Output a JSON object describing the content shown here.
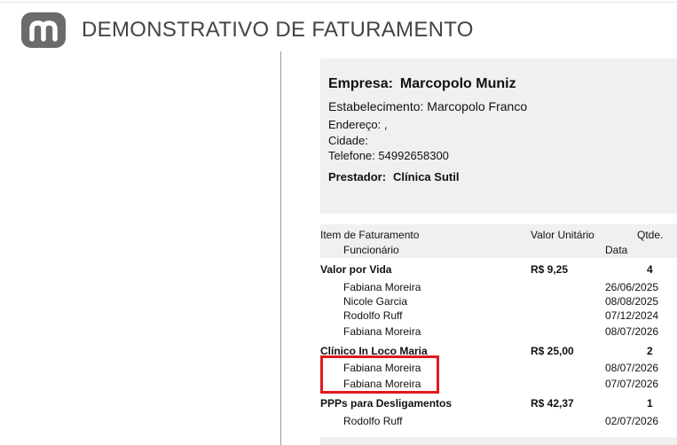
{
  "header": {
    "title": "DEMONSTRATIVO DE FATURAMENTO",
    "logo_icon": "m-logo-icon"
  },
  "info": {
    "empresa_label": "Empresa:",
    "empresa_value": "Marcopolo Muniz",
    "estabelecimento": "Estabelecimento: Marcopolo Franco",
    "endereco": "Endereço: ,",
    "cidade": "Cidade:",
    "telefone": "Telefone: 54992658300",
    "prestador_label": "Prestador:",
    "prestador_value": "Clínica Sutil"
  },
  "table": {
    "headers": {
      "item": "Item de Faturamento",
      "funcionario": "Funcionário",
      "valor": "Valor Unitário",
      "qtde": "Qtde.",
      "data": "Data"
    },
    "groups": [
      {
        "item": "Valor por Vida",
        "valor": "R$ 9,25",
        "qtde": "4",
        "rows": [
          {
            "funcionario": "Fabiana Moreira",
            "data": "26/06/2025"
          },
          {
            "funcionario": "Nicole Garcia",
            "data": "08/08/2025"
          },
          {
            "funcionario": "Rodolfo Ruff",
            "data": "07/12/2024"
          },
          {
            "funcionario": "Fabiana Moreira",
            "data": "08/07/2026"
          }
        ]
      },
      {
        "item": "Clínico In Loco Maria",
        "valor": "R$ 25,00",
        "qtde": "2",
        "rows": [
          {
            "funcionario": "Fabiana Moreira",
            "data": "08/07/2026"
          },
          {
            "funcionario": "Fabiana Moreira",
            "data": "07/07/2026"
          }
        ]
      },
      {
        "item": "PPPs para Desligamentos",
        "valor": "R$ 42,37",
        "qtde": "1",
        "rows": [
          {
            "funcionario": "Rodolfo Ruff",
            "data": "02/07/2026"
          }
        ]
      }
    ]
  },
  "highlight_color": "#e0191d"
}
